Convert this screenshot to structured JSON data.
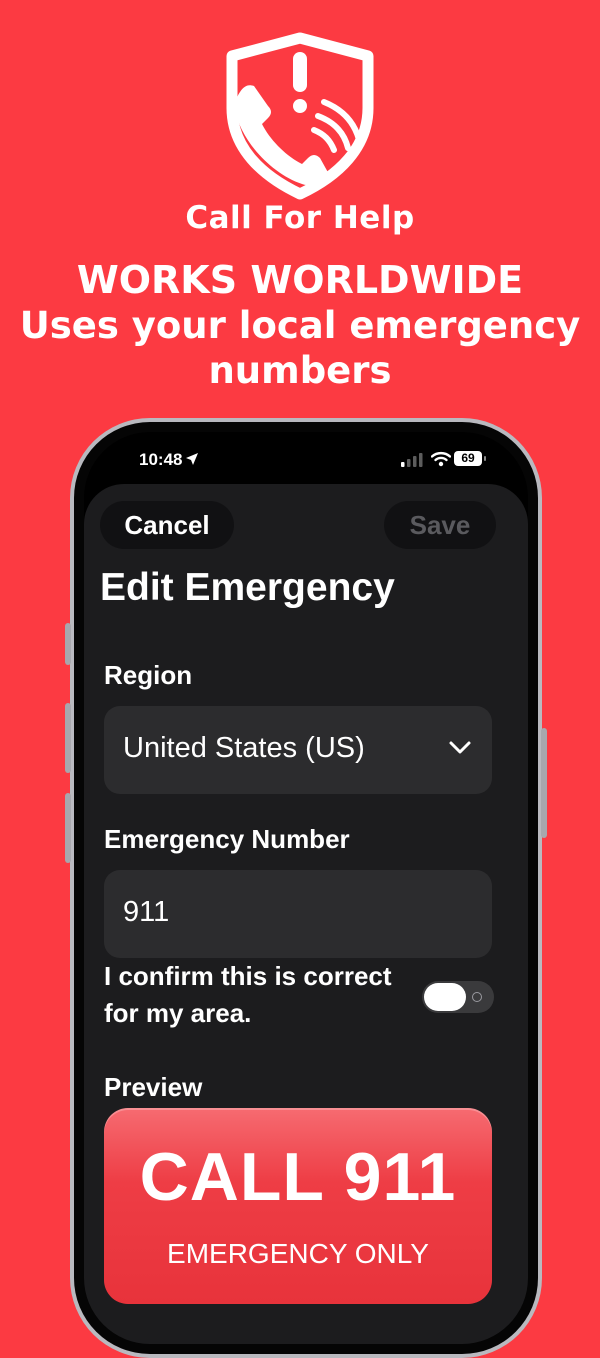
{
  "app": {
    "name": "Call For Help"
  },
  "marketing": {
    "headline_line1": "WORKS WORLDWIDE",
    "headline_line2": "Uses your local emergency",
    "headline_line3": "numbers"
  },
  "status_bar": {
    "time": "10:48",
    "battery": "69"
  },
  "nav": {
    "cancel_label": "Cancel",
    "save_label": "Save"
  },
  "page": {
    "title": "Edit Emergency"
  },
  "region": {
    "label": "Region",
    "value": "United States (US)"
  },
  "emergency_number": {
    "label": "Emergency Number",
    "value": "911"
  },
  "confirm": {
    "text": "I confirm this is correct for my area.",
    "enabled": false
  },
  "preview": {
    "label": "Preview",
    "call_text": "CALL 911",
    "sub_text": "EMERGENCY ONLY"
  },
  "colors": {
    "background": "#fc3a42",
    "call_button": "#ee3d45",
    "sheet": "#1c1c1e",
    "field": "#2c2c2e"
  },
  "icons": [
    "shield-phone-logo-icon",
    "location-arrow-icon",
    "signal-icon",
    "wifi-icon",
    "battery-icon",
    "chevron-down-icon"
  ]
}
